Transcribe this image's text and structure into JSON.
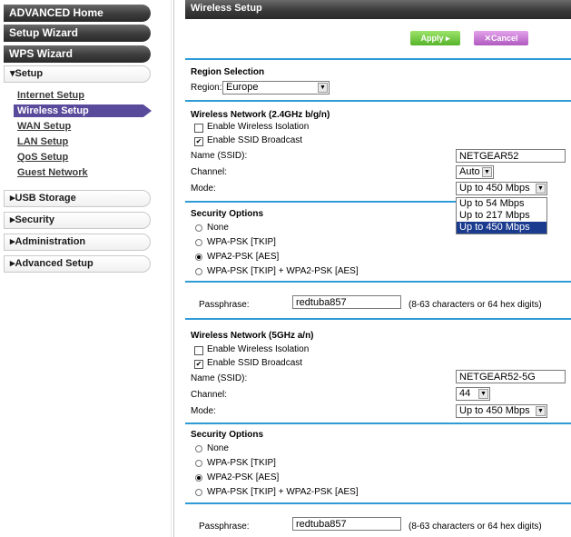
{
  "sidebar": {
    "advanced_home": "ADVANCED Home",
    "setup_wizard": "Setup Wizard",
    "wps_wizard": "WPS Wizard",
    "setup": "▾Setup",
    "setup_items": [
      "Internet Setup",
      "Wireless Setup",
      "WAN Setup",
      "LAN Setup",
      "QoS Setup",
      "Guest Network"
    ],
    "usb_storage": "▸USB Storage",
    "security": "▸Security",
    "administration": "▸Administration",
    "advanced_setup": "▸Advanced Setup"
  },
  "header": {
    "title": "Wireless Setup"
  },
  "toolbar": {
    "apply_label": "Apply ▸",
    "cancel_label": "✕Cancel"
  },
  "region": {
    "heading": "Region Selection",
    "label": "Region:",
    "value": "Europe"
  },
  "net24": {
    "heading": "Wireless Network (2.4GHz b/g/n)",
    "isolation_label": "Enable Wireless Isolation",
    "isolation_checked": false,
    "ssid_broadcast_label": "Enable SSID Broadcast",
    "ssid_broadcast_checked": true,
    "ssid_label": "Name (SSID):",
    "ssid_value": "NETGEAR52",
    "channel_label": "Channel:",
    "channel_value": "Auto",
    "mode_label": "Mode:",
    "mode_value": "Up to 450 Mbps",
    "mode_options": [
      "Up to 54 Mbps",
      "Up to 217 Mbps",
      "Up to 450 Mbps"
    ]
  },
  "sec24": {
    "heading": "Security Options",
    "options": [
      "None",
      "WPA-PSK [TKIP]",
      "WPA2-PSK [AES]",
      "WPA-PSK [TKIP] + WPA2-PSK [AES]"
    ],
    "selected_index": 2,
    "passphrase_label": "Passphrase:",
    "passphrase_value": "redtuba857",
    "passphrase_hint": "(8-63 characters or 64 hex digits)"
  },
  "net5": {
    "heading": "Wireless Network (5GHz a/n)",
    "isolation_label": "Enable Wireless Isolation",
    "isolation_checked": false,
    "ssid_broadcast_label": "Enable SSID Broadcast",
    "ssid_broadcast_checked": true,
    "ssid_label": "Name (SSID):",
    "ssid_value": "NETGEAR52-5G",
    "channel_label": "Channel:",
    "channel_value": "44",
    "mode_label": "Mode:",
    "mode_value": "Up to 450 Mbps"
  },
  "sec5": {
    "heading": "Security Options",
    "options": [
      "None",
      "WPA-PSK [TKIP]",
      "WPA2-PSK [AES]",
      "WPA-PSK [TKIP] + WPA2-PSK [AES]"
    ],
    "selected_index": 2,
    "passphrase_label": "Passphrase:",
    "passphrase_value": "redtuba857",
    "passphrase_hint": "(8-63 characters or 64 hex digits)"
  },
  "colors": {
    "accent_line": "#2e9bd6",
    "active_nav": "#5a4a9c",
    "apply_green": "#56b42a",
    "cancel_purple": "#b05ac0",
    "dropdown_highlight": "#1b3b8f"
  }
}
